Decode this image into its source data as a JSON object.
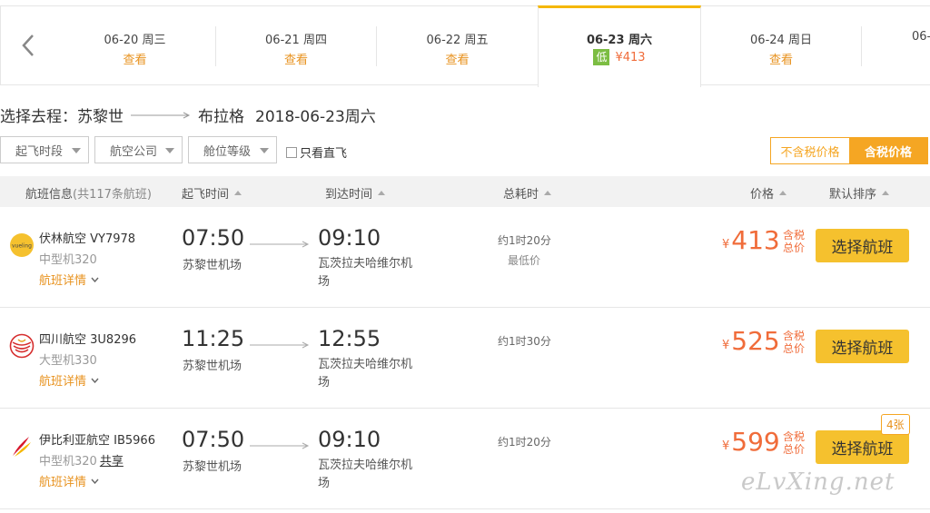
{
  "date_bar": {
    "dates": [
      {
        "date": "06-20 周三",
        "value": "查看"
      },
      {
        "date": "06-21 周四",
        "value": "查看"
      },
      {
        "date": "06-22 周五",
        "value": "查看"
      },
      {
        "date": "06-23 周六",
        "badge": "低",
        "value": "¥413"
      },
      {
        "date": "06-24 周日",
        "value": "查看"
      },
      {
        "date": "06-"
      }
    ]
  },
  "route": {
    "label": "选择去程：",
    "from": "苏黎世",
    "to": "布拉格",
    "date": "2018-06-23周六"
  },
  "filters": {
    "departure_time": "起飞时段",
    "airline": "航空公司",
    "cabin": "舱位等级",
    "direct_only": "只看直飞"
  },
  "tax_toggle": {
    "without_tax": "不含税价格",
    "with_tax": "含税价格"
  },
  "table_header": {
    "info": "航班信息",
    "count": "(共117条航班)",
    "departure": "起飞时间",
    "arrival": "到达时间",
    "duration": "总耗时",
    "price": "价格",
    "sort": "默认排序"
  },
  "flights": [
    {
      "airline": "伏林航空 VY7978",
      "logo": "vueling-logo",
      "plane": "中型机320",
      "share": "",
      "detail": "航班详情",
      "dep_time": "07:50",
      "dep_airport": "苏黎世机场",
      "arr_time": "09:10",
      "arr_airport": "瓦茨拉夫哈维尔机场",
      "duration": "约1时20分",
      "note": "最低价",
      "currency": "¥",
      "price": "413",
      "tax_label": "含税总价",
      "button": "选择航班",
      "seats": ""
    },
    {
      "airline": "四川航空 3U8296",
      "logo": "sichuan-airlines-logo",
      "plane": "大型机330",
      "share": "",
      "detail": "航班详情",
      "dep_time": "11:25",
      "dep_airport": "苏黎世机场",
      "arr_time": "12:55",
      "arr_airport": "瓦茨拉夫哈维尔机场",
      "duration": "约1时30分",
      "note": "",
      "currency": "¥",
      "price": "525",
      "tax_label": "含税总价",
      "button": "选择航班",
      "seats": ""
    },
    {
      "airline": "伊比利亚航空 IB5966",
      "logo": "iberia-logo",
      "plane": "中型机320",
      "share": "共享",
      "detail": "航班详情",
      "dep_time": "07:50",
      "dep_airport": "苏黎世机场",
      "arr_time": "09:10",
      "arr_airport": "瓦茨拉夫哈维尔机场",
      "duration": "约1时20分",
      "note": "",
      "currency": "¥",
      "price": "599",
      "tax_label": "含税总价",
      "button": "选择航班",
      "seats": "4张"
    }
  ],
  "watermark": "eLvXing.net",
  "colors": {
    "accent_orange": "#f5a623",
    "price_red": "#f06c3a",
    "button_yellow": "#f5c12e",
    "low_green": "#7cbd43"
  }
}
